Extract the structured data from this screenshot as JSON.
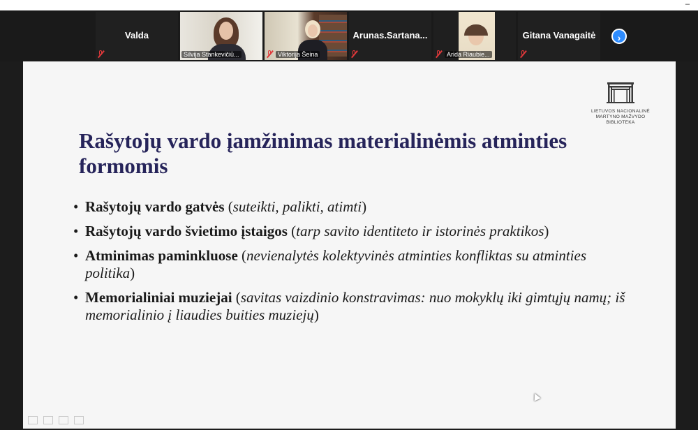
{
  "window": {
    "minimize_glyph": "–"
  },
  "participants": [
    {
      "name": "Valda",
      "label": "",
      "muted": true,
      "video": false
    },
    {
      "name": "",
      "label": "Silvija Stankevičiū...",
      "muted": false,
      "video": true,
      "active": true
    },
    {
      "name": "",
      "label": "Viktorija Šeina",
      "muted": true,
      "video": true
    },
    {
      "name": "Arunas.Sartana...",
      "label": "",
      "muted": true,
      "video": false
    },
    {
      "name": "",
      "label": "Arida Riaubie...",
      "muted": true,
      "video": true
    },
    {
      "name": "Gitana Vanagaitė",
      "label": "",
      "muted": true,
      "video": false
    }
  ],
  "next_page_glyph": "›",
  "slide": {
    "logo_text": [
      "LIETUVOS NACIONALINĖ",
      "MARTYNO MAŽVYDO",
      "BIBLIOTEKA"
    ],
    "title": "Rašytojų vardo įamžinimas materialinėmis atminties formomis",
    "bullets": [
      {
        "bold": "Rašytojų vardo gatvės",
        "pre": " (",
        "italic": "suteikti, palikti, atimti",
        "post": ")"
      },
      {
        "bold": "Rašytojų vardo švietimo įstaigos",
        "pre": " (",
        "italic": "tarp savito identiteto ir istorinės praktikos",
        "post": ")"
      },
      {
        "bold": "Atminimas paminkluose",
        "pre": " (",
        "italic": "nevienalytės kolektyvinės atminties konfliktas su atminties politika",
        "post": ")"
      },
      {
        "bold": "Memorialiniai muziejai",
        "pre": " (",
        "italic": "savitas vaizdinio konstravimas: nuo mokyklų iki gimtųjų namų; iš memorialinio į liaudies buities muziejų",
        "post": ")"
      }
    ]
  },
  "colors": {
    "active_speaker": "#c8e34a",
    "title": "#26245a",
    "next_button": "#2d8cff",
    "muted_icon": "#e0383a"
  }
}
